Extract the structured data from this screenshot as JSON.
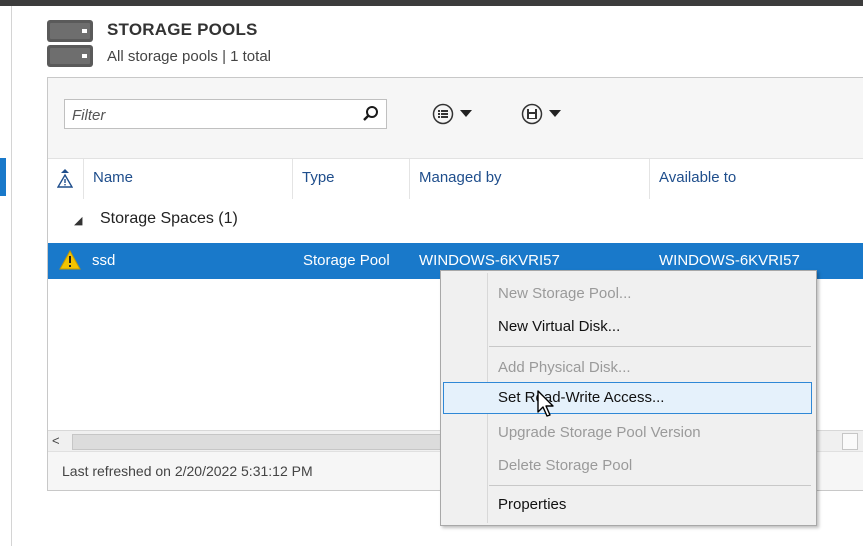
{
  "header": {
    "title": "STORAGE POOLS",
    "subtitle": "All storage pools | 1 total",
    "icon": "server-storage-icon"
  },
  "toolbar": {
    "filter_placeholder": "Filter",
    "filter_icon": "search-icon",
    "view_button_icon": "list-options-icon",
    "save_button_icon": "save-disk-icon"
  },
  "table": {
    "columns": [
      "Name",
      "Type",
      "Managed by",
      "Available to"
    ],
    "group": {
      "label": "Storage Spaces (1)"
    },
    "rows": [
      {
        "status_icon": "warning-icon",
        "name": "ssd",
        "type": "Storage Pool",
        "managed_by": "WINDOWS-6KVRI57",
        "available_to": "WINDOWS-6KVRI57"
      }
    ]
  },
  "status_bar": {
    "text": "Last refreshed on 2/20/2022 5:31:12 PM"
  },
  "context_menu": {
    "items": [
      {
        "label": "New Storage Pool...",
        "enabled": false
      },
      {
        "label": "New Virtual Disk...",
        "enabled": true
      },
      {
        "label": "Add Physical Disk...",
        "enabled": false
      },
      {
        "label": "Set Read-Write Access...",
        "enabled": true,
        "hovered": true
      },
      {
        "label": "Upgrade Storage Pool Version",
        "enabled": false
      },
      {
        "label": "Delete Storage Pool",
        "enabled": false
      },
      {
        "label": "Properties",
        "enabled": true
      }
    ]
  },
  "colors": {
    "selection": "#1979ca",
    "header_text": "#1f4e8c",
    "menu_hover_border": "#2f88d6",
    "warning": "#f4c400"
  }
}
